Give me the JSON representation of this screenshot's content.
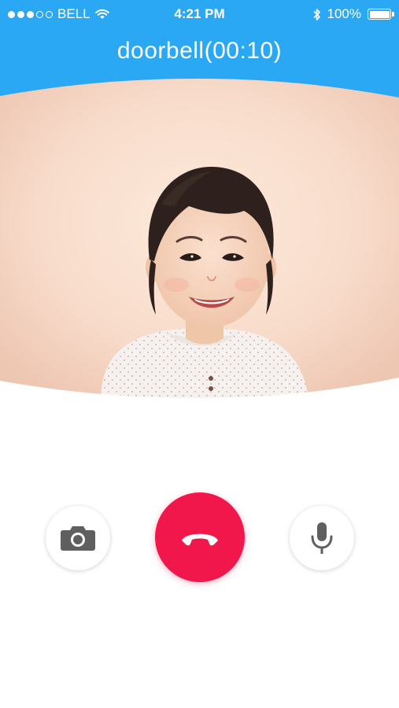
{
  "status_bar": {
    "carrier": "BELL",
    "signal_filled": 3,
    "signal_total": 5,
    "time": "4:21 PM",
    "battery": "100%",
    "icons": [
      "wifi-icon",
      "bluetooth-icon",
      "battery-icon"
    ]
  },
  "header": {
    "title": "doorbell(00:10)"
  },
  "controls": {
    "camera": {
      "icon": "camera-icon"
    },
    "hangup": {
      "icon": "phone-hangup-icon"
    },
    "mic": {
      "icon": "microphone-icon"
    }
  },
  "colors": {
    "header_bg": "#2aa8f4",
    "hangup_bg": "#f2174b",
    "icon_gray": "#5f5f5f"
  }
}
